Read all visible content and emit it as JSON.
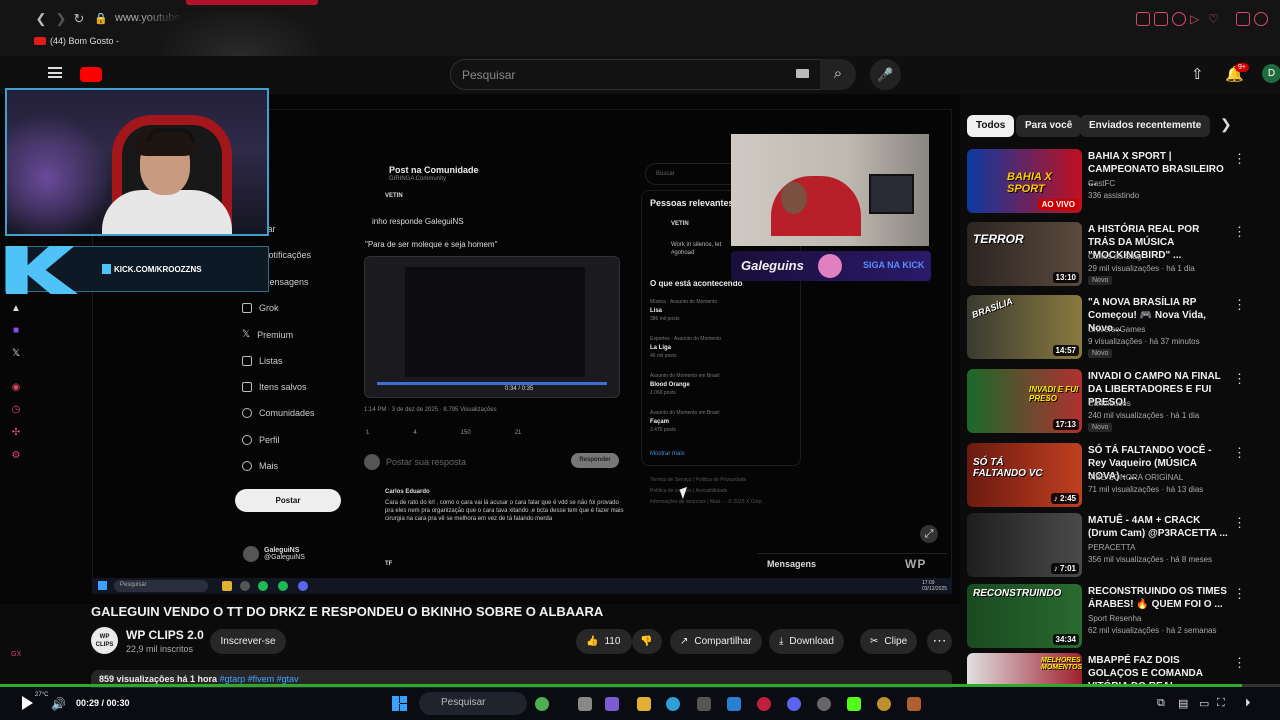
{
  "browser": {
    "url": "www.youtube.c",
    "tab_title": "(44) Bom Gosto -"
  },
  "header": {
    "search_placeholder": "Pesquisar",
    "notification_count": "9+",
    "avatar_letter": "D"
  },
  "stream_overlay": {
    "kick_url": "KICK.COM/KROOZZNS",
    "galeguins_label": "Galeguins",
    "galeguins_kick": "SIGA NA KICK"
  },
  "x_page": {
    "nav": [
      "Explorar",
      "Notificações",
      "Mensagens",
      "Grok",
      "Premium",
      "Listas",
      "Itens salvos",
      "Comunidades",
      "Perfil",
      "Mais"
    ],
    "post_button": "Postar",
    "profile_name": "GaleguiNS",
    "profile_handle": "@GaleguiNS",
    "post_header": "Post na Comunidade",
    "post_community": "GIRINGA Community",
    "post_author": "VETIN",
    "post_reply_to": "inho responde GaleguiNS",
    "post_quote": "\"Para de ser moleque e seja homem\"",
    "video_time": "0:34 / 0:35",
    "post_meta": "1:14 PM · 3 de dez de 2025 · 8.795 Visualizações",
    "post_stats": [
      "1",
      "4",
      "150",
      "21"
    ],
    "reply_placeholder": "Postar sua resposta",
    "reply_button": "Responder",
    "comment_author": "Carlos Eduardo",
    "comment_text": "Cara de rato do krl , como o cara vai lá acusar o cara falar que é vdd se não foi provado pra eles nem pra organização que o cara tava xitando ,e bcta desse tem que é fazer mais cirurgia na cara pra vê se melhora em vez de tá falando merda",
    "comment2_author": "TF",
    "search_placeholder": "Buscar",
    "relevant_title": "Pessoas relevantes",
    "relevant_name": "VETIN",
    "relevant_text": "Work in silence, let #gohoad",
    "happening_title": "O que está acontecendo",
    "trends": [
      {
        "category": "Música · Assunto do Momento",
        "name": "Lisa",
        "posts": "386 mil posts"
      },
      {
        "category": "Esportes · Assunto do Momento",
        "name": "La Liga",
        "posts": "46 mil posts"
      },
      {
        "category": "Assunto do Momento em Brasil",
        "name": "Blood Orange",
        "posts": "1.066 posts"
      },
      {
        "category": "Assunto do Momento em Brasil",
        "name": "Façam",
        "posts": "3.475 posts"
      }
    ],
    "show_more": "Mostrar mais",
    "footer_line1": "Termos de Serviço | Política de Privacidade",
    "footer_line2": "Política de cookies | Acessibilidade",
    "footer_line3": "Informações de anúncios | Mais ··· © 2025 X Corp.",
    "messages": "Mensagens",
    "watermark": "WP"
  },
  "video_taskbar": {
    "search": "Pesquisar",
    "clock": "17:09 03/12/2025"
  },
  "video": {
    "title": "GALEGUIN VENDO O TT DO DRKZ E RESPONDEU O BKINHO SOBRE O ALBAARA",
    "channel_name": "WP CLIPS 2.0",
    "channel_avatar": "WP CLIPS",
    "subscribers": "22,9 mil inscritos",
    "subscribe": "Inscrever-se",
    "likes": "110",
    "share": "Compartilhar",
    "download": "Download",
    "clip": "Clipe",
    "views": "859 visualizações  há 1 hora",
    "tags": "#gtarp #fivem #gtav"
  },
  "sidebar_chips": [
    "Todos",
    "Para você",
    "Enviados recentemente"
  ],
  "recommendations": [
    {
      "title": "BAHIA X SPORT | CAMPEONATO BRASILEIRO ...",
      "channel": "CastFC",
      "meta": "336 assistindo",
      "badge": "AO VIVO",
      "thumb_text": "BAHIA X SPORT"
    },
    {
      "title": "A HISTÓRIA REAL POR TRÁS DA MÚSICA \"MOCKINGBIRD\" ...",
      "channel": "Cortes do Stag",
      "meta": "29 mil visualizações · há 1 dia",
      "duration": "13:10",
      "new": "Novo",
      "thumb_text": "TERROR"
    },
    {
      "title": "\"A NOVA BRASÍLIA RP Começou! 🎮 Nova Vida, Novo...",
      "channel": "UniverseGames",
      "meta": "9 visualizações · há 37 minutos",
      "duration": "14:57",
      "new": "Novo",
      "thumb_text": "BRASÍLIA"
    },
    {
      "title": "INVADI O CAMPO NA FINAL DA LIBERTADORES E FUI PRESO!",
      "channel": "Cartoloucos",
      "meta": "240 mil visualizações · há 1 dia",
      "duration": "17:13",
      "new": "Novo",
      "thumb_text": "INVADI E FUI PRESO"
    },
    {
      "title": "SÓ TÁ FALTANDO VOCÊ - Rey Vaqueiro (MÚSICA NOVA) - ...",
      "channel": "VIBE SONORA ORIGINAL",
      "meta": "71 mil visualizações · há 13 dias",
      "duration": "♪ 2:45",
      "thumb_text": "SÓ TÁ FALTANDO VC"
    },
    {
      "title": "MATUÊ - 4AM + CRACK (Drum Cam) @P3RACETTA ...",
      "channel": "PERACETTA",
      "meta": "356 mil visualizações · há 8 meses",
      "duration": "♪ 7:01",
      "thumb_text": ""
    },
    {
      "title": "RECONSTRUINDO OS TIMES ÁRABES! 🔥 QUEM FOI O ...",
      "channel": "Sport Resenha",
      "meta": "62 mil visualizações · há 2 semanas",
      "duration": "34:34",
      "thumb_text": "RECONSTRUINDO"
    },
    {
      "title": "MBAPPÉ FAZ DOIS GOLAÇOS E COMANDA VITÓRIA DO REAL ...",
      "channel": "",
      "meta": "",
      "thumb_text": "MELHORES MOMENTOS"
    }
  ],
  "player": {
    "progress": 0.97,
    "time": "00:29 / 00:30",
    "weather": "27°C"
  },
  "taskbar": {
    "search": "Pesquisar"
  },
  "colors": {
    "youtube_red": "#ff0000",
    "kick_green": "#53fc18",
    "link_blue": "#3ea6ff"
  }
}
